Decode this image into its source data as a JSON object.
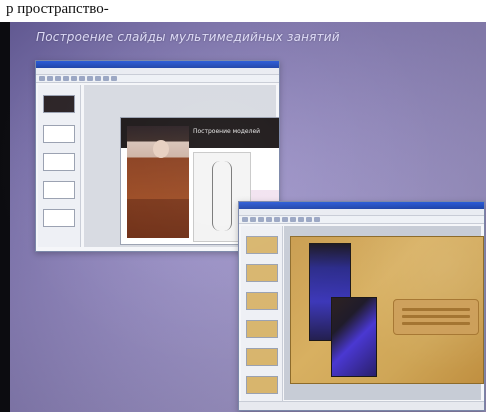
{
  "caption": {
    "top_text": "р прострапство-"
  },
  "projection": {
    "slide_title": "Построение слайды мультимедийных занятий"
  },
  "window1": {
    "slide_label": "Построение моделей"
  },
  "window2": {}
}
